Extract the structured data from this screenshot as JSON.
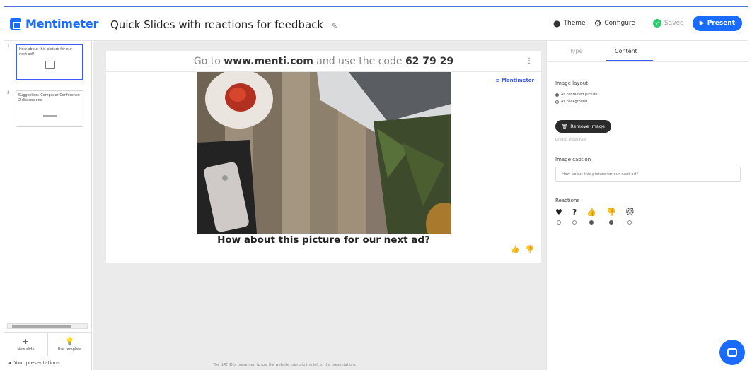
{
  "app": {
    "name": "Mentimeter"
  },
  "presentation": {
    "title": "Quick Slides with reactions for feedback"
  },
  "toolbar": {
    "theme_label": "Theme",
    "configure_label": "Configure",
    "saved_label": "Saved",
    "present_label": "Present"
  },
  "sidebar": {
    "slides": [
      {
        "number": "1",
        "text": "How about this picture for our next ad?"
      },
      {
        "number": "2",
        "text": "Suggestion: Composer Conference 2 discussions"
      }
    ],
    "new_slide_label": "New slide",
    "use_template_label": "Use template",
    "your_presentations_label": "Your presentations"
  },
  "slide": {
    "code_prefix": "Go to",
    "code_url": "www.menti.com",
    "code_mid": "and use the code",
    "code_value": "62 79 29",
    "brand_mark": "Mentimeter",
    "caption": "How about this picture for our next ad?"
  },
  "footer_note": "The NAT ID is presented to use the website menu to the left of the presentations",
  "panel": {
    "tabs": [
      "Type",
      "Content"
    ],
    "active_tab": "Content",
    "image_layout_label": "Image layout",
    "layout_options": [
      "As contained picture",
      "As background"
    ],
    "remove_image_label": "Remove image",
    "drop_hint": "Or drop image here",
    "image_caption_label": "Image caption",
    "image_caption_value": "How about this picture for our next ad?",
    "reactions_label": "Reactions",
    "reactions": [
      {
        "icon": "heart-icon",
        "glyph": "♥",
        "checked": false
      },
      {
        "icon": "question-icon",
        "glyph": "?",
        "checked": false
      },
      {
        "icon": "thumbs-up-icon",
        "glyph": "👍",
        "checked": true
      },
      {
        "icon": "thumbs-down-icon",
        "glyph": "👎",
        "checked": true
      },
      {
        "icon": "cat-icon",
        "glyph": "🐱",
        "checked": false
      }
    ]
  },
  "colors": {
    "brand": "#196cff",
    "saved": "#2ecc71",
    "dark_button": "#2b2b2b"
  }
}
